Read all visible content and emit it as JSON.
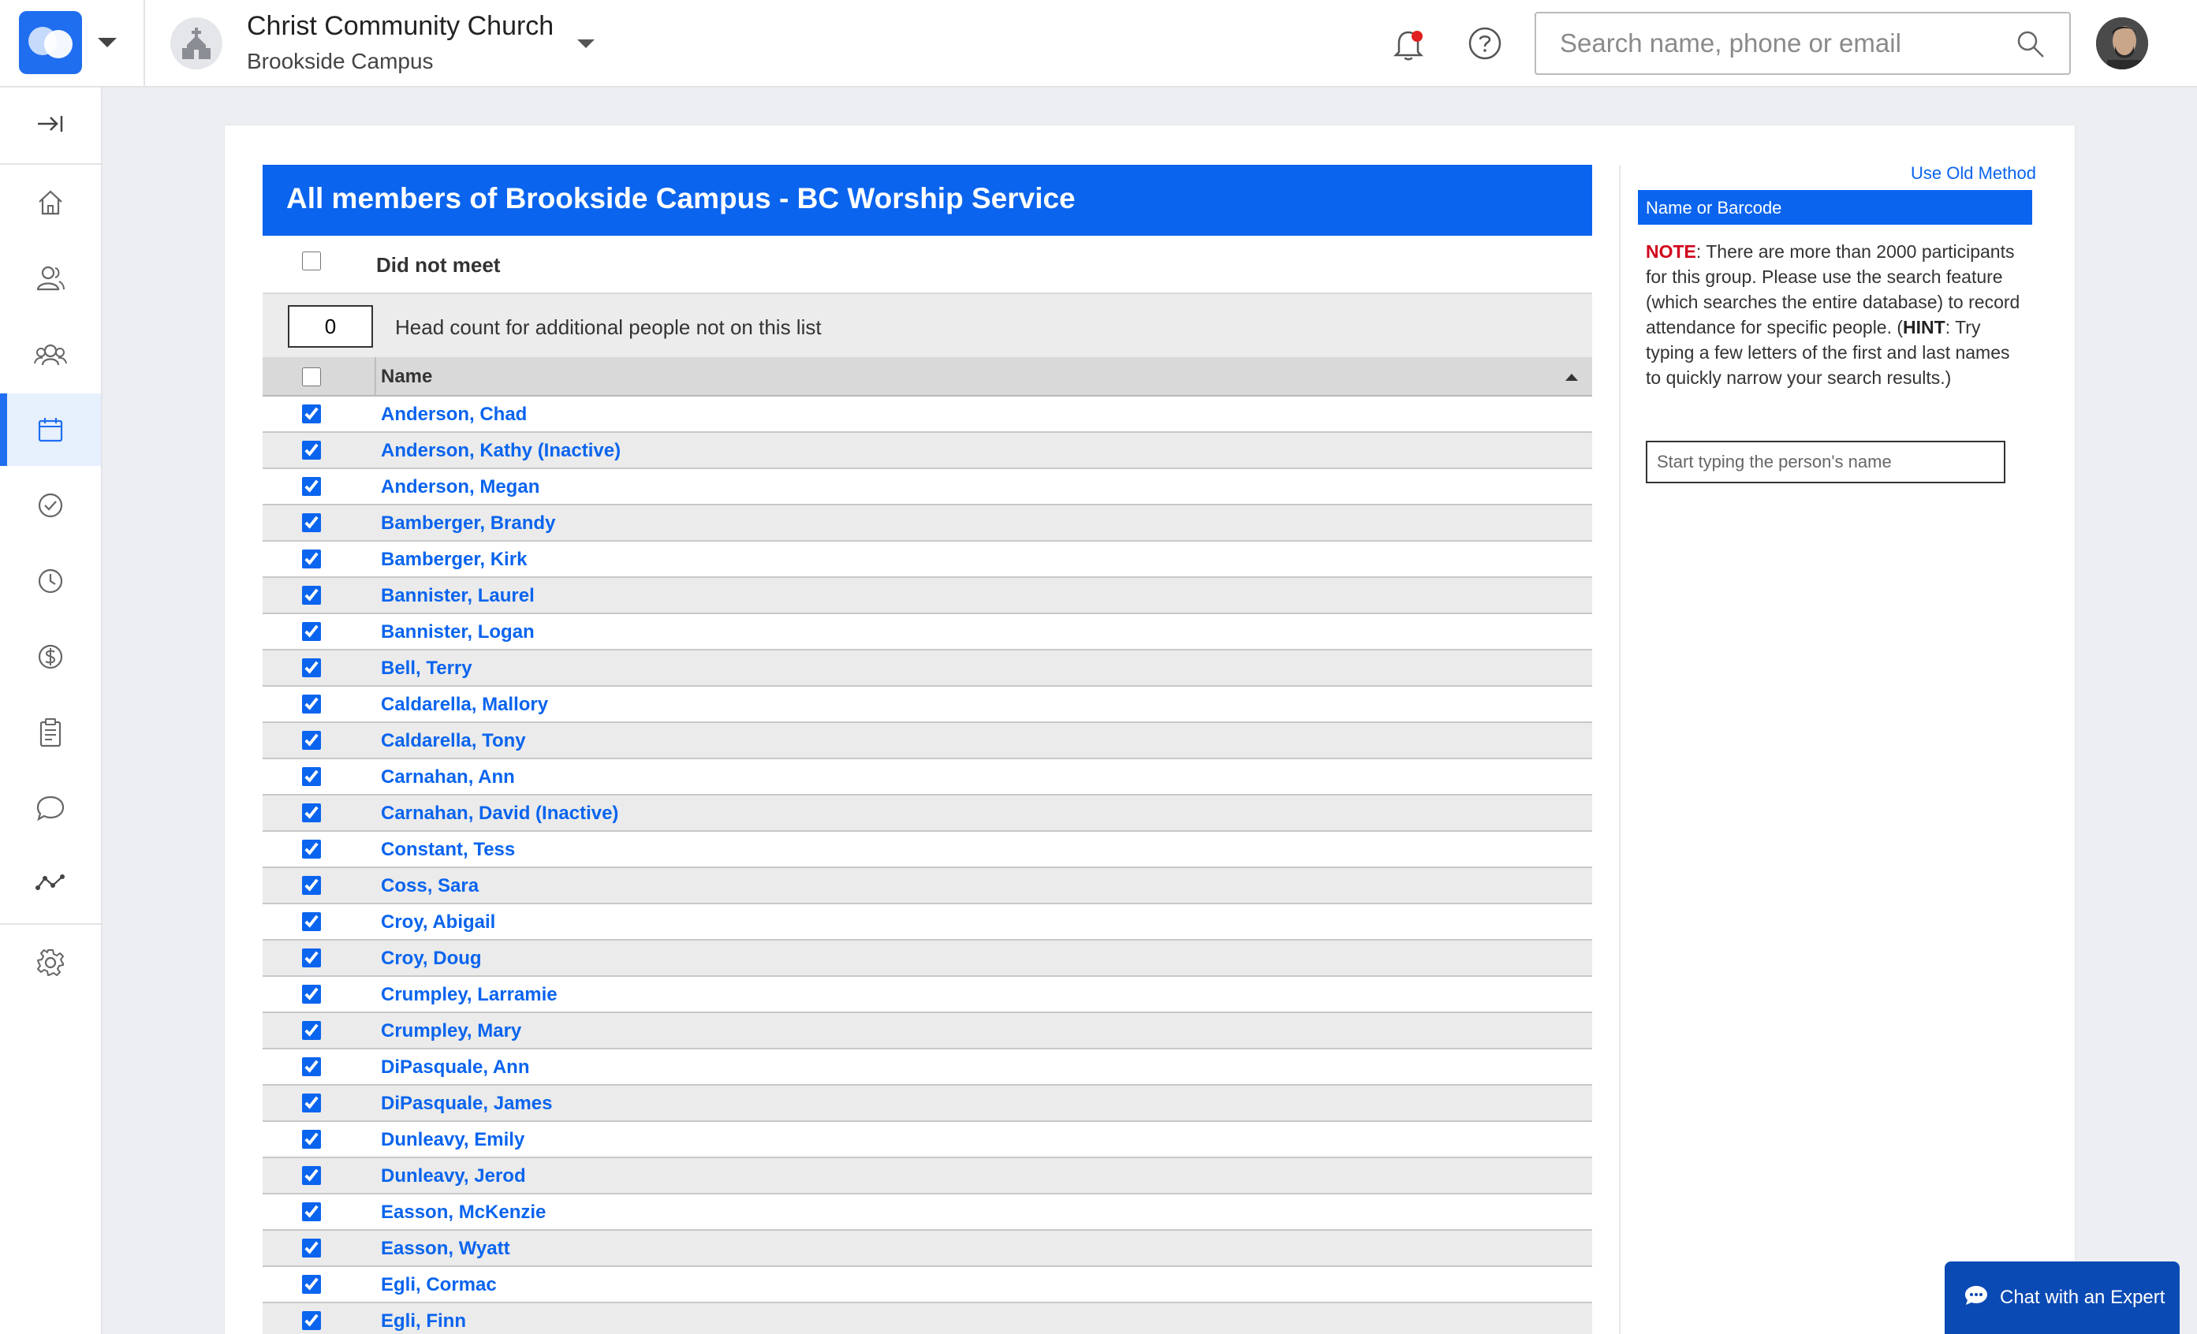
{
  "header": {
    "church_name": "Christ Community Church",
    "campus_name": "Brookside Campus",
    "search_placeholder": "Search name, phone or email"
  },
  "sidebar": {
    "items": [
      {
        "name": "collapse-sidebar-icon",
        "active": false
      },
      {
        "name": "home-icon",
        "active": false
      },
      {
        "name": "people-icon",
        "active": false
      },
      {
        "name": "groups-icon",
        "active": false
      },
      {
        "name": "calendar-icon",
        "active": true
      },
      {
        "name": "check-circle-icon",
        "active": false
      },
      {
        "name": "clock-icon",
        "active": false
      },
      {
        "name": "dollar-icon",
        "active": false
      },
      {
        "name": "clipboard-icon",
        "active": false
      },
      {
        "name": "chat-icon",
        "active": false
      },
      {
        "name": "analytics-icon",
        "active": false
      },
      {
        "name": "gear-icon",
        "active": false
      }
    ]
  },
  "attendance": {
    "group_title": "All members of Brookside Campus - BC Worship Service",
    "did_not_meet_label": "Did not meet",
    "head_count_value": "0",
    "head_count_label": "Head count for additional people not on this list",
    "name_column_header": "Name",
    "members": [
      {
        "name": "Anderson, Chad",
        "checked": true
      },
      {
        "name": "Anderson, Kathy (Inactive)",
        "checked": true
      },
      {
        "name": "Anderson, Megan",
        "checked": true
      },
      {
        "name": "Bamberger, Brandy",
        "checked": true
      },
      {
        "name": "Bamberger, Kirk",
        "checked": true
      },
      {
        "name": "Bannister, Laurel",
        "checked": true
      },
      {
        "name": "Bannister, Logan",
        "checked": true
      },
      {
        "name": "Bell, Terry",
        "checked": true
      },
      {
        "name": "Caldarella, Mallory",
        "checked": true
      },
      {
        "name": "Caldarella, Tony",
        "checked": true
      },
      {
        "name": "Carnahan, Ann",
        "checked": true
      },
      {
        "name": "Carnahan, David (Inactive)",
        "checked": true
      },
      {
        "name": "Constant, Tess",
        "checked": true
      },
      {
        "name": "Coss, Sara",
        "checked": true
      },
      {
        "name": "Croy, Abigail",
        "checked": true
      },
      {
        "name": "Croy, Doug",
        "checked": true
      },
      {
        "name": "Crumpley, Larramie",
        "checked": true
      },
      {
        "name": "Crumpley, Mary",
        "checked": true
      },
      {
        "name": "DiPasquale, Ann",
        "checked": true
      },
      {
        "name": "DiPasquale, James",
        "checked": true
      },
      {
        "name": "Dunleavy, Emily",
        "checked": true
      },
      {
        "name": "Dunleavy, Jerod",
        "checked": true
      },
      {
        "name": "Easson, McKenzie",
        "checked": true
      },
      {
        "name": "Easson, Wyatt",
        "checked": true
      },
      {
        "name": "Egli, Cormac",
        "checked": true
      },
      {
        "name": "Egli, Finn",
        "checked": true
      }
    ]
  },
  "right_panel": {
    "use_old_method": "Use Old Method",
    "name_or_barcode": "Name or Barcode",
    "note_label": "NOTE",
    "note_text": ": There are more than 2000 participants for this group. Please use the search feature (which searches the entire database) to record attendance for specific people. (",
    "hint_label": "HINT",
    "hint_text": ": Try typing a few letters of the first and last names to quickly narrow your search results.)",
    "search_placeholder": "Start typing the person's name"
  },
  "chat": {
    "label": "Chat with an Expert"
  },
  "colors": {
    "brand_blue": "#0a64ee",
    "note_red": "#d0021b"
  }
}
